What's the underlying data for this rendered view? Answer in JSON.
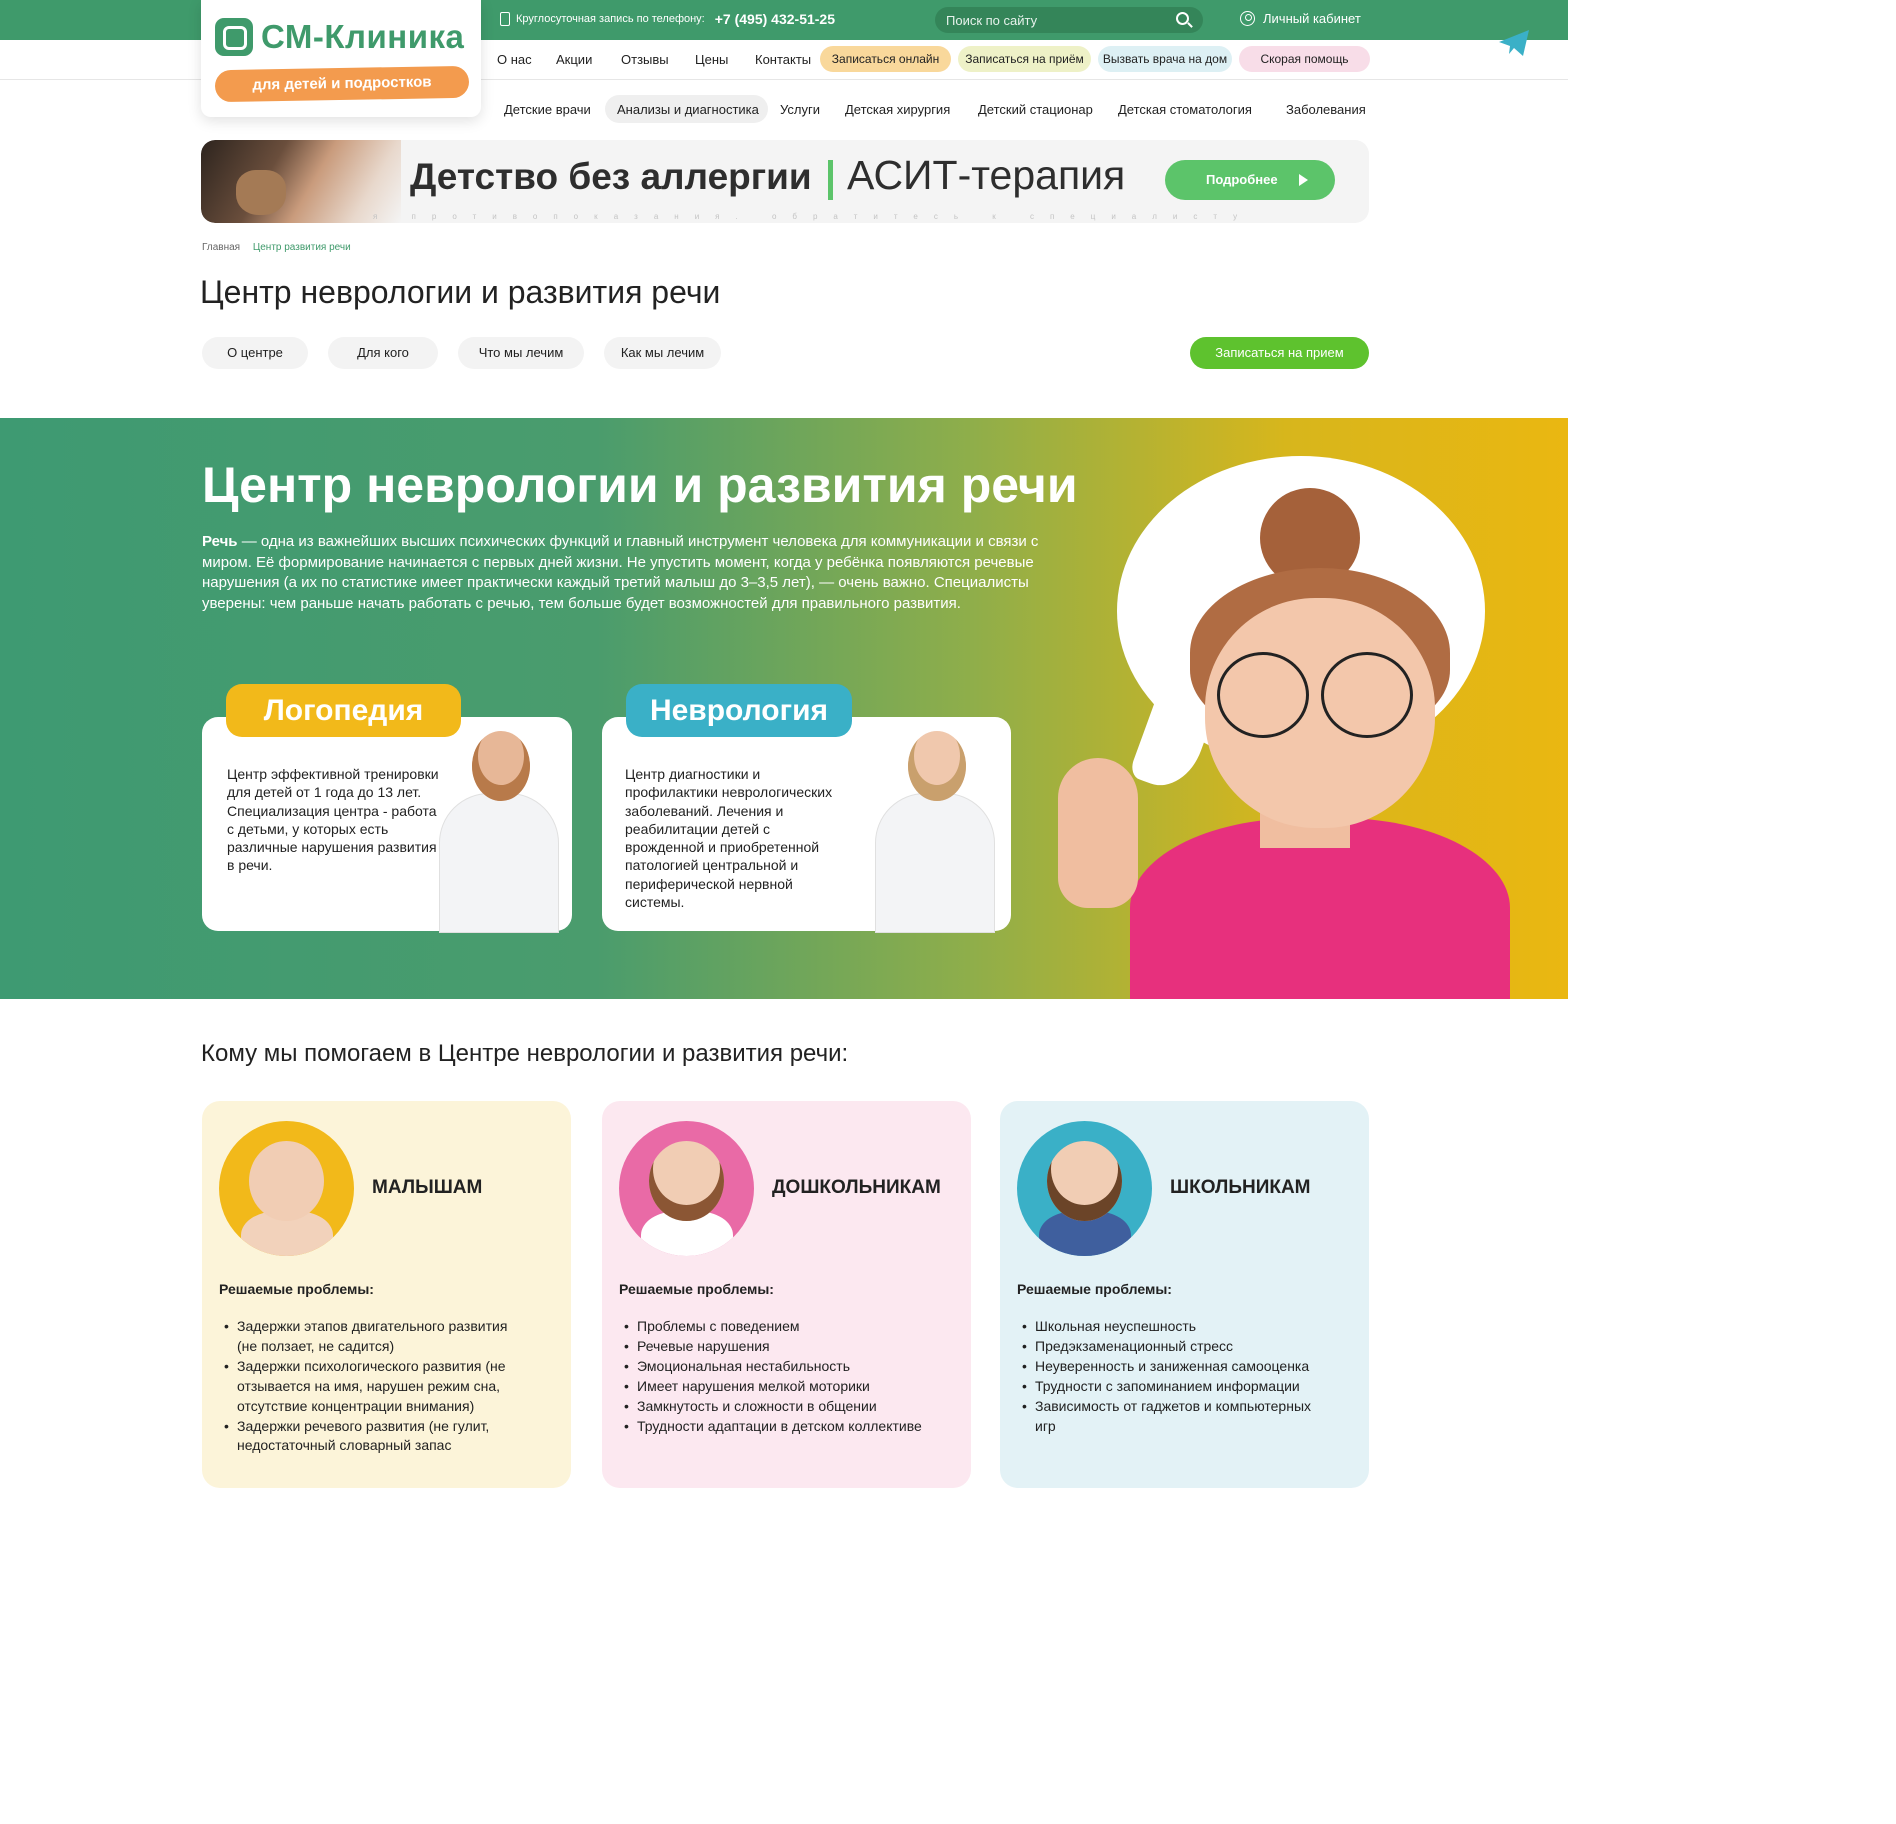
{
  "header": {
    "phone_label": "Круглосуточная запись по телефону:",
    "phone_number": "+7 (495) 432-51-25",
    "search_placeholder": "Поиск по сайту",
    "cabinet_label": "Личный кабинет",
    "logo_text": "СМ-Клиника",
    "logo_sub": "для детей и подростков"
  },
  "nav_top": [
    "О нас",
    "Акции",
    "Отзывы",
    "Цены",
    "Контакты"
  ],
  "action_pills": [
    {
      "label": "Записаться онлайн",
      "color": "#f9d89b"
    },
    {
      "label": "Записаться на приём",
      "color": "#eef1c7"
    },
    {
      "label": "Вызвать врача на дом",
      "color": "#ddf0f4"
    },
    {
      "label": "Скорая помощь",
      "color": "#f8dde8"
    }
  ],
  "nav_main": [
    "Детские врачи",
    "Анализы и диагностика",
    "Услуги",
    "Детская хирургия",
    "Детский стационар",
    "Детская стоматология",
    "Заболевания"
  ],
  "banner": {
    "title": "Детство без аллергии",
    "subtitle": "АСИТ-терапия",
    "button": "Подробнее",
    "disclaimer": "я противопоказания. обратитесь к специалисту"
  },
  "breadcrumb": {
    "home": "Главная",
    "current": "Центр развития речи"
  },
  "page_title": "Центр неврологии и развития речи",
  "tabs": [
    "О центре",
    "Для кого",
    "Что мы лечим",
    "Как мы лечим"
  ],
  "appoint_button": "Записаться на прием",
  "hero": {
    "title": "Центр неврологии и развития речи",
    "text_bold": "Речь",
    "text": " — одна из важнейших высших психических функций и главный инструмент человека для коммуникации и связи с миром. Её формирование начинается с первых дней жизни. Не упустить момент, когда у ребёнка появляются речевые нарушения (а их по статистике имеет практически каждый третий малыш до 3–3,5 лет), — очень важно. Специалисты уверены: чем раньше начать работать с речью, тем больше будет возможностей для правильного развития.",
    "cards": [
      {
        "label": "Логопедия",
        "color": "#f2b91a",
        "text": "Центр эффективной тренировки для детей от 1 года до 13 лет. Специализация центра - работа с детьми, у которых есть различные нарушения развития в речи."
      },
      {
        "label": "Неврология",
        "color": "#3ab0c7",
        "text": "Центр диагностики и профилактики неврологических заболеваний. Лечения и реабилитации детей с врожденной и приобретенной патологией центральной и периферической нервной системы."
      }
    ]
  },
  "section_title": "Кому мы помогаем в Центре неврологии и развития речи:",
  "audiences": [
    {
      "title": "МАЛЫШАМ",
      "bg": "#fcf4d9",
      "photo_bg": "#f2b91a",
      "sub": "Решаемые проблемы:",
      "items": [
        "Задержки этапов двигательного развития (не ползает, не садится)",
        "Задержки психологического развития (не отзывается на имя, нарушен режим сна, отсутствие концентрации внимания)",
        "Задержки речевого развития (не гулит, недостаточный словарный запас"
      ]
    },
    {
      "title": "ДОШКОЛЬНИКАМ",
      "bg": "#fce8f0",
      "photo_bg": "#e96aa6",
      "sub": "Решаемые проблемы:",
      "items": [
        "Проблемы с поведением",
        "Речевые нарушения",
        "Эмоциональная нестабильность",
        "Имеет нарушения мелкой моторики",
        "Замкнутость и сложности в общении",
        "Трудности адаптации в детском коллективе"
      ]
    },
    {
      "title": "ШКОЛЬНИКАМ",
      "bg": "#e3f2f6",
      "photo_bg": "#3ab0c7",
      "sub": "Решаемые проблемы:",
      "items": [
        "Школьная неуспешность",
        "Предэкзаменационный стресс",
        "Неуверенность и заниженная самооценка",
        "Трудности с запоминанием информации",
        "Зависимость от гаджетов и компьютерных игр"
      ]
    }
  ],
  "colors": {
    "brand_green": "#3f9a6b",
    "accent_green": "#5ec22e",
    "orange": "#f39b4e"
  }
}
